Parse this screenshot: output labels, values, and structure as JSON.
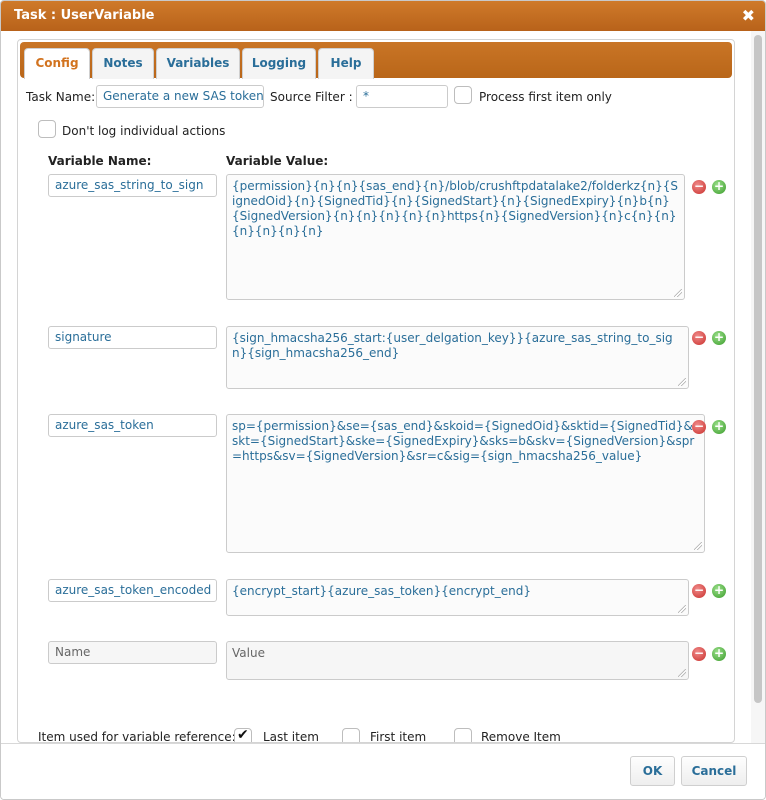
{
  "window": {
    "title": "Task : UserVariable",
    "close_glyph": "✖"
  },
  "tabs": [
    {
      "label": "Config",
      "active": true
    },
    {
      "label": "Notes",
      "active": false
    },
    {
      "label": "Variables",
      "active": false
    },
    {
      "label": "Logging",
      "active": false
    },
    {
      "label": "Help",
      "active": false
    }
  ],
  "form": {
    "task_name_label": "Task Name:",
    "task_name_value": "Generate a new SAS token",
    "source_filter_label": "Source Filter :",
    "source_filter_value": "*",
    "process_first_label": "Process first item only",
    "process_first_checked": false,
    "dont_log_label": "Don't log individual actions",
    "dont_log_checked": false,
    "var_name_header": "Variable Name:",
    "var_value_header": "Variable Value:"
  },
  "variables": [
    {
      "name": "azure_sas_string_to_sign",
      "value": "{permission}{n}{n}{sas_end}{n}/blob/crushftpdatalake2/folderkz{n}{SignedOid}{n}{SignedTid}{n}{SignedStart}{n}{SignedExpiry}{n}b{n}{SignedVersion}{n}{n}{n}{n}{n}https{n}{SignedVersion}{n}c{n}{n}{n}{n}{n}{n}"
    },
    {
      "name": "signature",
      "value": "{sign_hmacsha256_start:{user_delgation_key}}{azure_sas_string_to_sign}{sign_hmacsha256_end}"
    },
    {
      "name": "azure_sas_token",
      "value": "sp={permission}&se={sas_end}&skoid={SignedOid}&sktid={SignedTid}&skt={SignedStart}&ske={SignedExpiry}&sks=b&skv={SignedVersion}&spr=https&sv={SignedVersion}&sr=c&sig={sign_hmacsha256_value}"
    },
    {
      "name": "azure_sas_token_encoded",
      "value": "{encrypt_start}{azure_sas_token}{encrypt_end}"
    }
  ],
  "new_variable": {
    "name_placeholder": "Name",
    "value_placeholder": "Value"
  },
  "reference": {
    "label": "Item used for variable reference:",
    "options": [
      {
        "label": "Last item",
        "checked": true
      },
      {
        "label": "First item",
        "checked": false
      },
      {
        "label": "Remove Item",
        "checked": false
      }
    ]
  },
  "footer": {
    "ok_label": "OK",
    "cancel_label": "Cancel"
  },
  "colors": {
    "accent": "#c26d20",
    "link_text": "#2a6e99",
    "active_tab": "#d2731f"
  }
}
